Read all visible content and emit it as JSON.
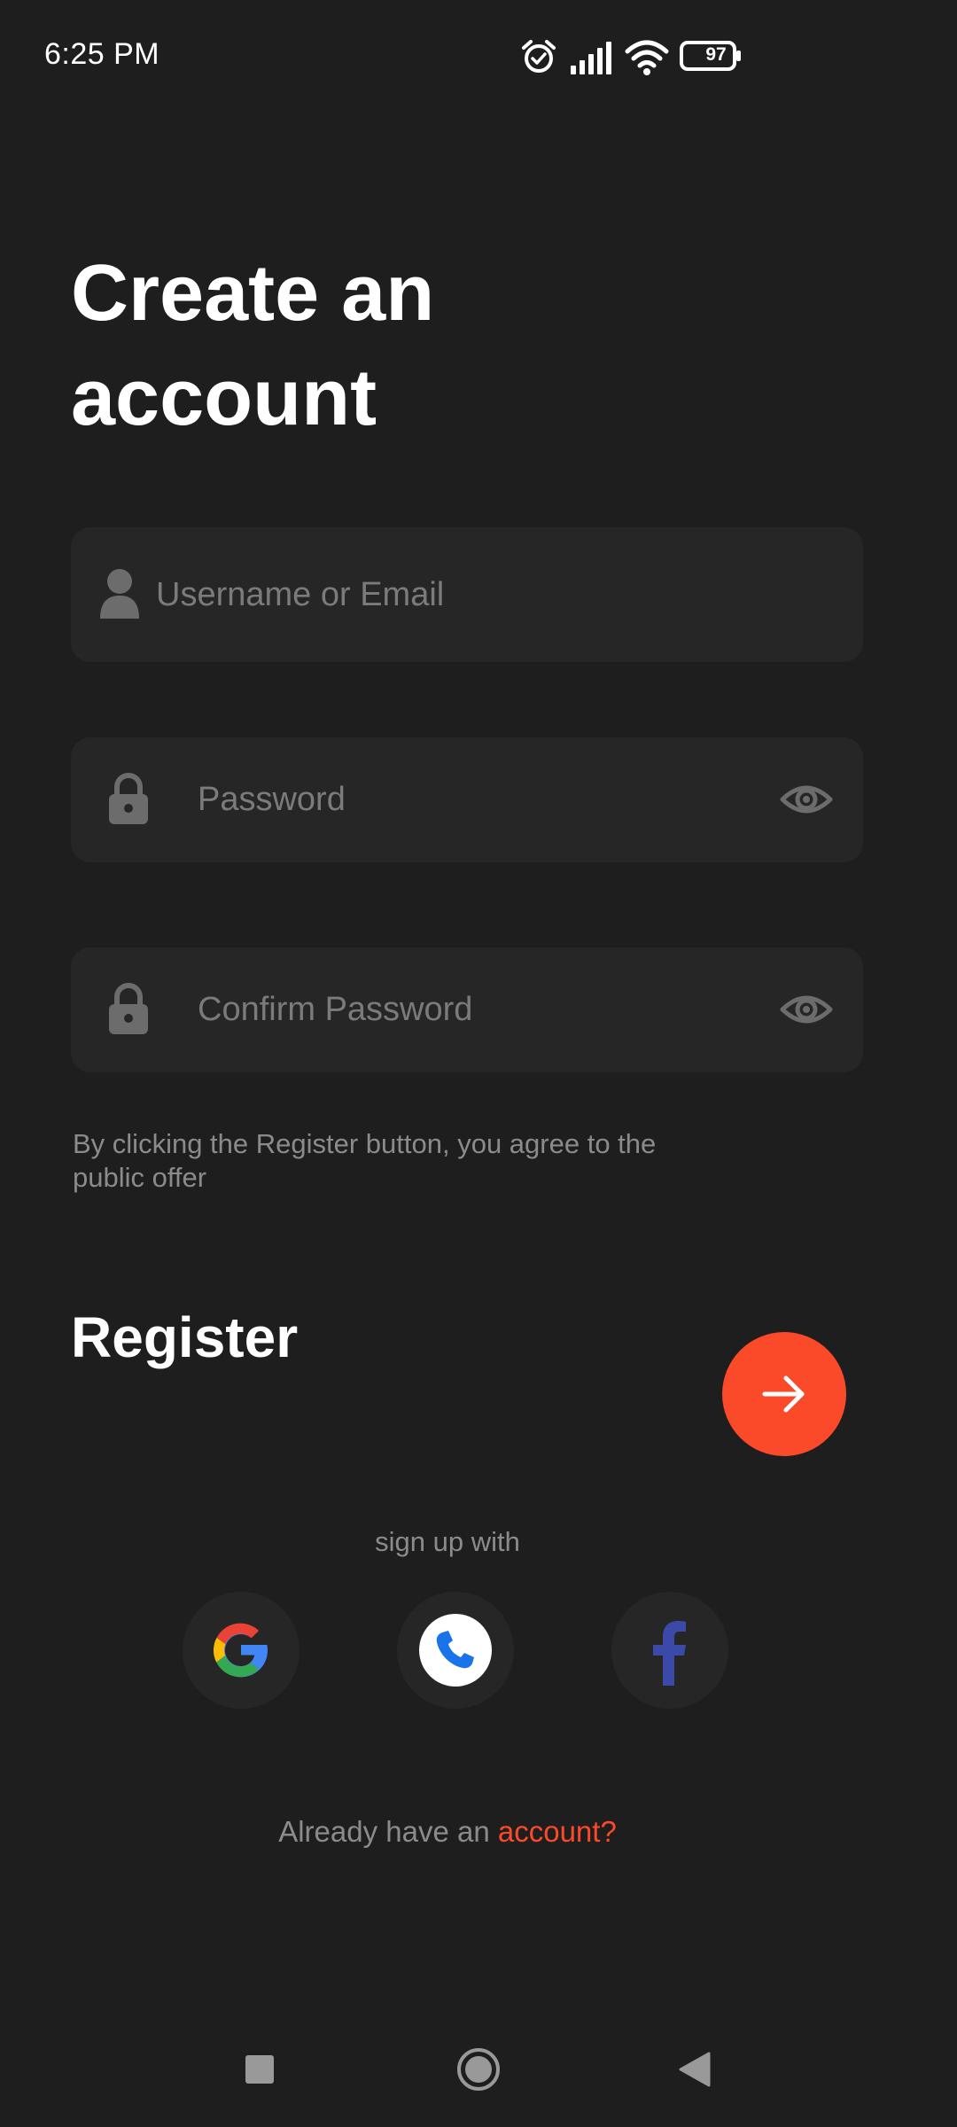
{
  "status_bar": {
    "time": "6:25 PM",
    "battery": "97",
    "icons": [
      "alarm-icon",
      "signal-icon",
      "wifi-icon",
      "battery-icon"
    ]
  },
  "title": "Create an account",
  "fields": {
    "username": {
      "placeholder": "Username or Email",
      "value": "",
      "icon": "user-icon"
    },
    "password": {
      "placeholder": "Password",
      "value": "",
      "icon": "lock-icon",
      "toggle_icon": "eye-icon"
    },
    "confirm_password": {
      "placeholder": "Confirm Password",
      "value": "",
      "icon": "lock-icon",
      "toggle_icon": "eye-icon"
    }
  },
  "terms": "By clicking the Register button, you agree to the public offer",
  "register": {
    "label": "Register",
    "icon": "arrow-right-icon"
  },
  "signup_with": "sign up with",
  "social": [
    {
      "name": "Google",
      "icon": "google-icon"
    },
    {
      "name": "Phone",
      "icon": "phone-icon"
    },
    {
      "name": "Facebook",
      "icon": "facebook-icon"
    }
  ],
  "login": {
    "prefix": "Already have an",
    "link": "account?"
  },
  "nav_bar": {
    "icons": [
      "recents-square-icon",
      "home-circle-icon",
      "back-triangle-icon"
    ]
  },
  "colors": {
    "background": "#1f1e1f",
    "field_background": "#272627",
    "accent": "#fa4a2a",
    "muted_text": "#8c8b8c",
    "placeholder": "#7c7b7c"
  }
}
